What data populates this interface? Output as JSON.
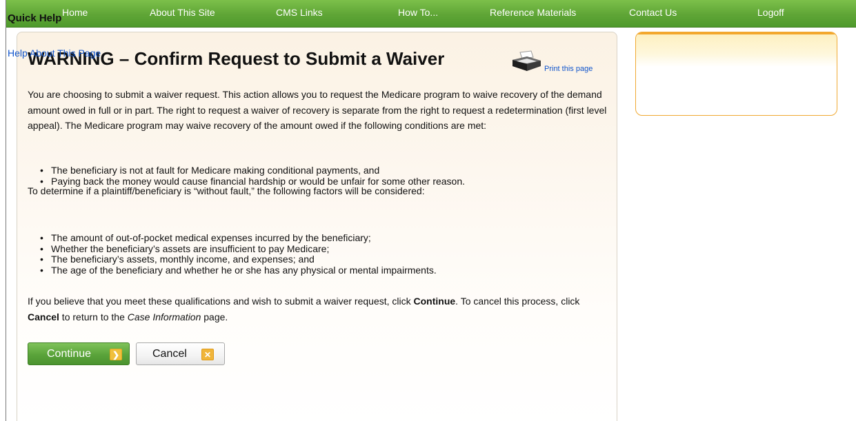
{
  "nav": {
    "items": [
      {
        "label": "Home"
      },
      {
        "label": "About This Site"
      },
      {
        "label": "CMS Links"
      },
      {
        "label": "How To..."
      },
      {
        "label": "Reference Materials"
      },
      {
        "label": "Contact Us"
      },
      {
        "label": "Logoff"
      }
    ]
  },
  "main": {
    "title": "WARNING – Confirm Request to Submit a Waiver",
    "print_label": "Print this page",
    "paragraph1": "You are choosing to submit a waiver request. This action allows you to request the Medicare program to waive recovery of the demand amount owed in full or in part. The right to request a waiver of recovery is separate from the right to request a redetermination (first level appeal). The Medicare program may waive recovery of the amount owed if the following conditions are met:",
    "list1": [
      "The beneficiary is not at fault for Medicare making conditional payments, and",
      "Paying back the money would cause financial hardship or would be unfair for some other reason."
    ],
    "paragraph2": "To determine if a plaintiff/beneficiary is “without fault,” the following factors will be considered:",
    "list2": [
      "The amount of out-of-pocket medical expenses incurred by the beneficiary;",
      "Whether the beneficiary’s assets are insufficient to pay Medicare;",
      "The beneficiary’s assets, monthly income, and expenses; and",
      "The age of the beneficiary and whether he or she has any physical or mental impairments."
    ],
    "paragraph3": {
      "part1": "If you believe that you meet these qualifications and wish to submit a waiver request, click ",
      "continue_word": "Continue",
      "part2": ". To cancel this process, click ",
      "cancel_word": "Cancel",
      "part3": " to return to the ",
      "page_name": "Case Information",
      "part4": " page."
    },
    "buttons": {
      "continue_label": "Continue",
      "continue_icon": "arrow-right-icon",
      "cancel_label": "Cancel",
      "cancel_icon": "close-x-icon"
    }
  },
  "quick_help": {
    "title": "Quick Help",
    "link": "Help About This Page"
  },
  "colors": {
    "nav_green": "#5fa536",
    "link_blue": "#1155cc",
    "quick_help_orange": "#f0a830",
    "icon_yellow": "#f0c03c"
  }
}
